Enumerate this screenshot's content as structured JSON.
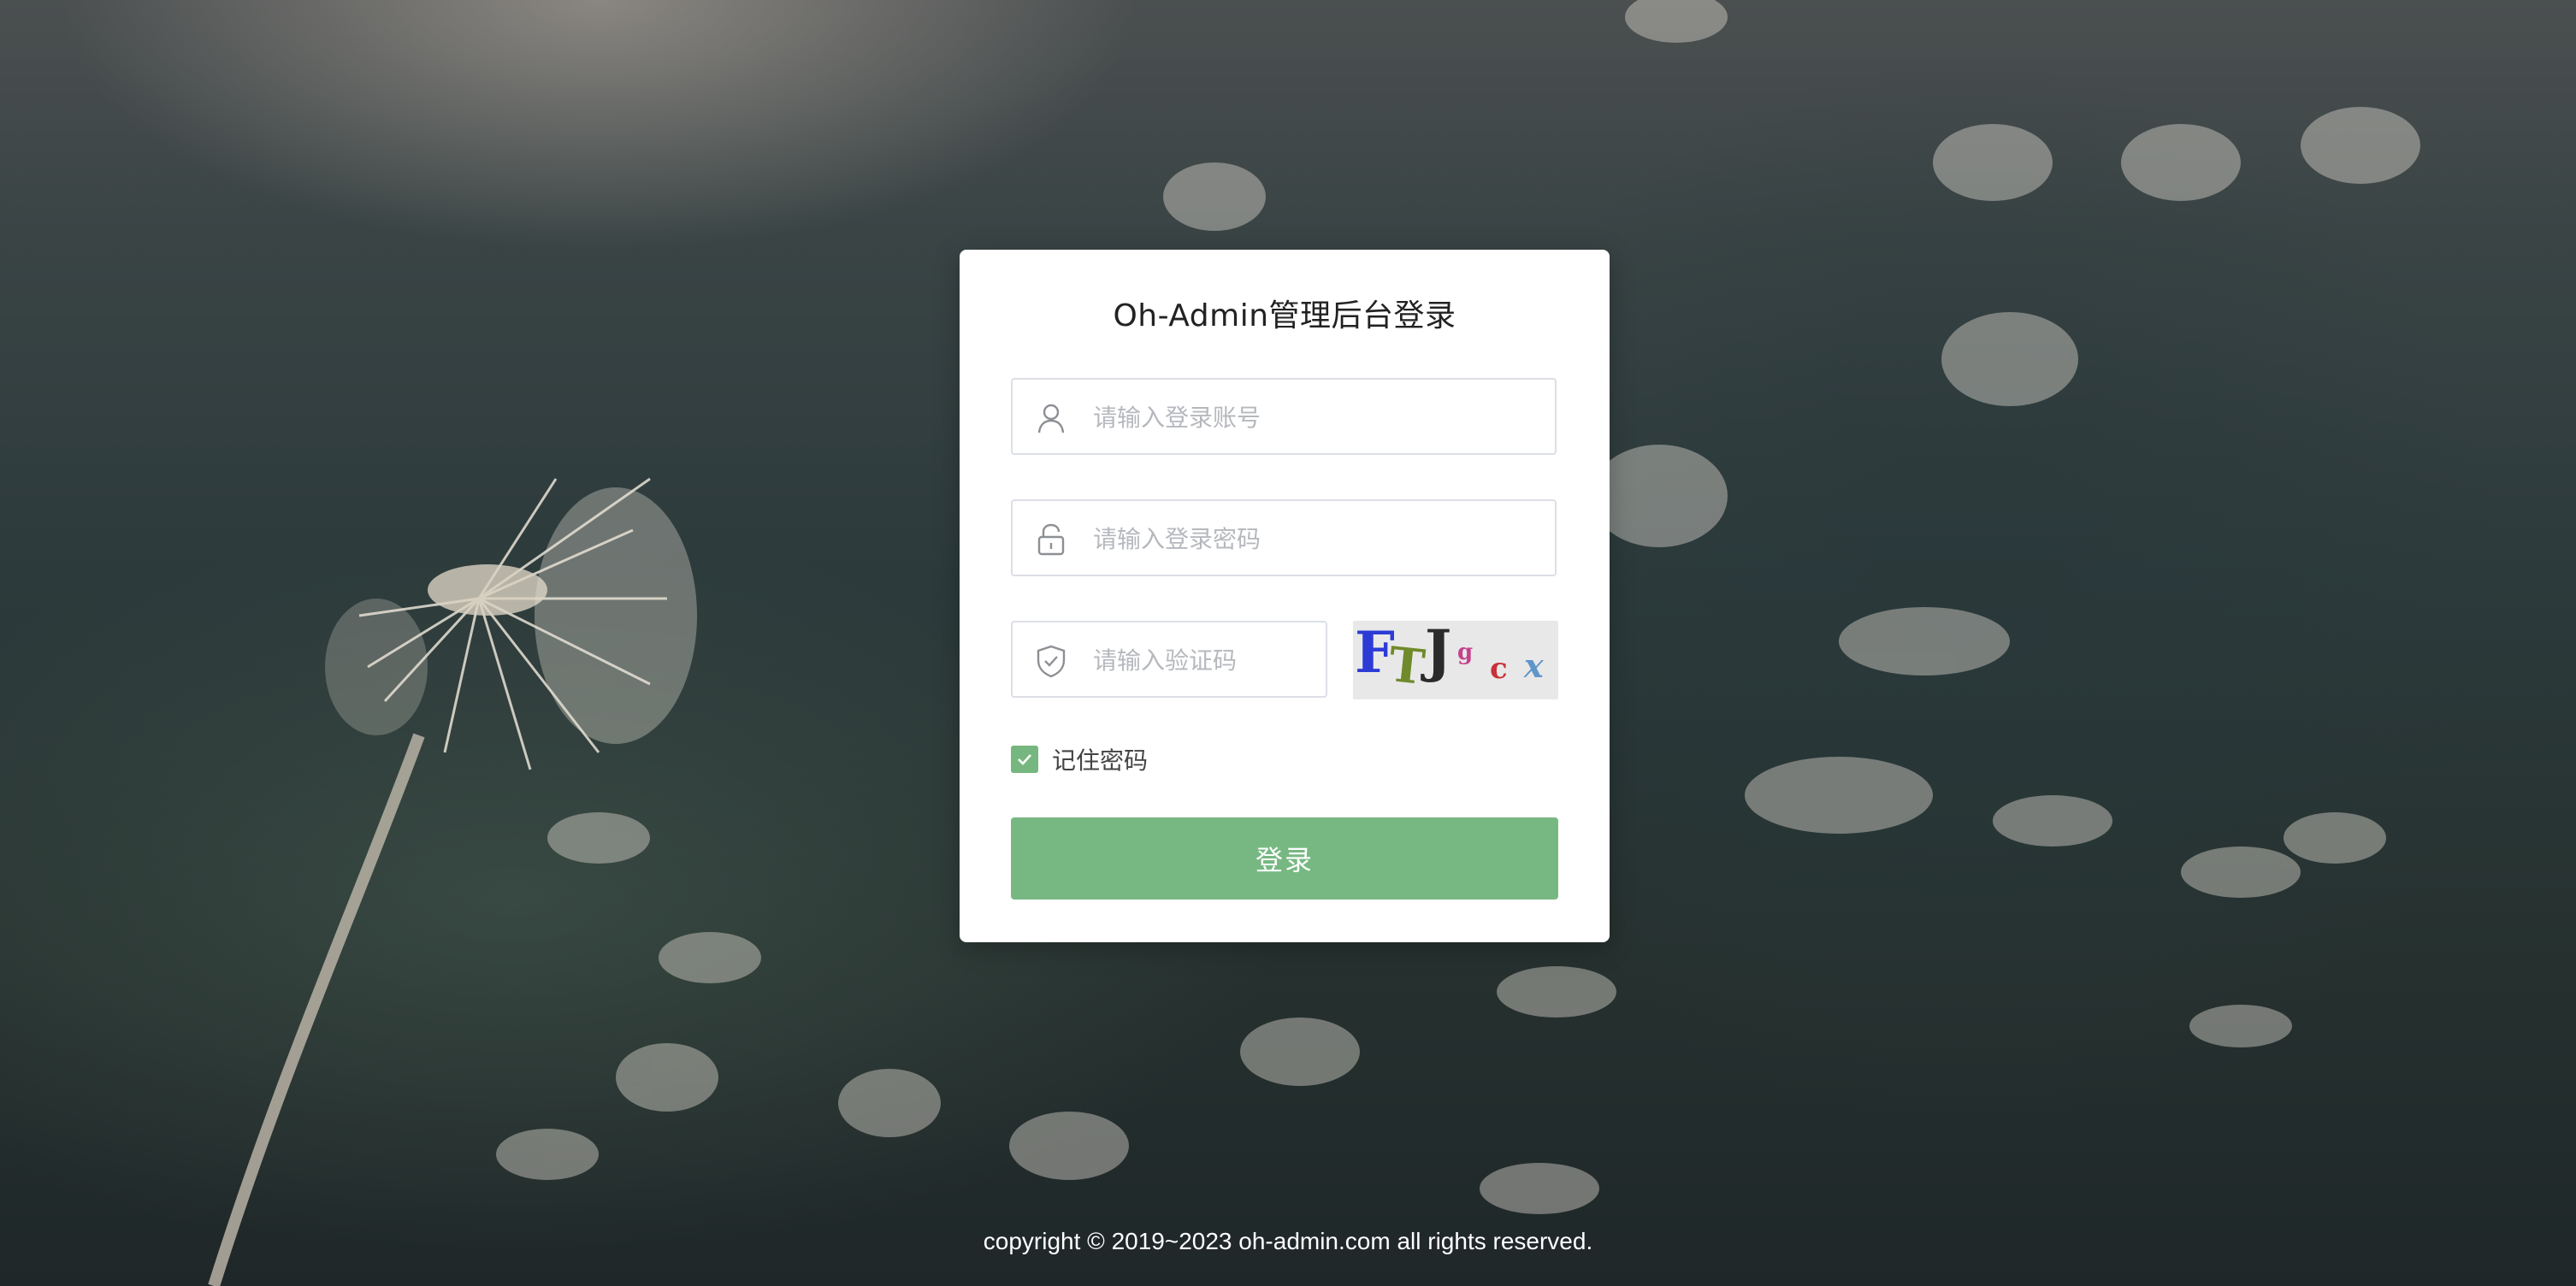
{
  "login": {
    "title": "Oh-Admin管理后台登录",
    "username_placeholder": "请输入登录账号",
    "password_placeholder": "请输入登录密码",
    "captcha_placeholder": "请输入验证码",
    "captcha_chars": [
      "F",
      "T",
      "J",
      "g",
      "c",
      "x"
    ],
    "remember_label": "记住密码",
    "remember_checked": true,
    "submit_label": "登录"
  },
  "footer": {
    "copyright": "copyright © 2019~2023 oh-admin.com all rights reserved."
  },
  "colors": {
    "accent": "#77b882",
    "card_bg": "#ffffff",
    "background_dark": "#26312f"
  },
  "icons": {
    "username": "user-icon",
    "password": "unlock-icon",
    "captcha": "shield-check-icon",
    "remember": "check-icon"
  }
}
